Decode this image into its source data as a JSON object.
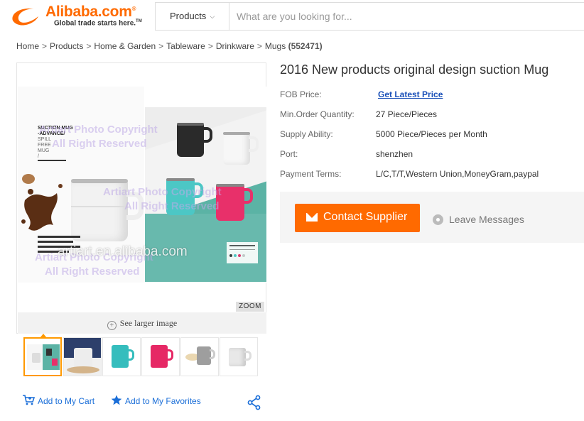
{
  "header": {
    "logo_text": "Alibaba.com",
    "logo_reg": "®",
    "tagline": "Global trade starts here.",
    "tagline_tm": "TM",
    "category_label": "Products",
    "search_placeholder": "What are you looking for..."
  },
  "breadcrumb": {
    "items": [
      "Home",
      "Products",
      "Home & Garden",
      "Tableware",
      "Drinkware",
      "Mugs"
    ],
    "separator": ">",
    "count": "(552471)"
  },
  "gallery": {
    "watermark": "artiart.en.alibaba.com",
    "overlay_lines": [
      "Artiart Photo Copyright",
      "All Right Reserved"
    ],
    "product_label": [
      "SUCTION MUG",
      "-ADVANCE/",
      "SPILL",
      "FREE",
      "MUG",
      "/"
    ],
    "zoom_label": "ZOOM",
    "see_larger_label": "See larger image",
    "thumbnail_count": 6
  },
  "actions": {
    "add_to_cart": "Add to My Cart",
    "add_to_favorites": "Add to My Favorites"
  },
  "product": {
    "title": "2016 New products original design suction Mug",
    "attributes": [
      {
        "label": "FOB Price:",
        "value": "Get Latest Price",
        "is_link": true
      },
      {
        "label": "Min.Order Quantity:",
        "value": "27 Piece/Pieces"
      },
      {
        "label": "Supply Ability:",
        "value": "5000 Piece/Pieces per Month"
      },
      {
        "label": "Port:",
        "value": "shenzhen"
      },
      {
        "label": "Payment Terms:",
        "value": "L/C,T/T,Western Union,MoneyGram,paypal"
      }
    ],
    "contact_button": "Contact Supplier",
    "leave_messages": "Leave Messages"
  },
  "colors": {
    "brand_orange": "#ff6a00",
    "link_blue": "#1a6ed8",
    "teal": "#5bb3a5",
    "thumb_active": "#ff9900"
  }
}
